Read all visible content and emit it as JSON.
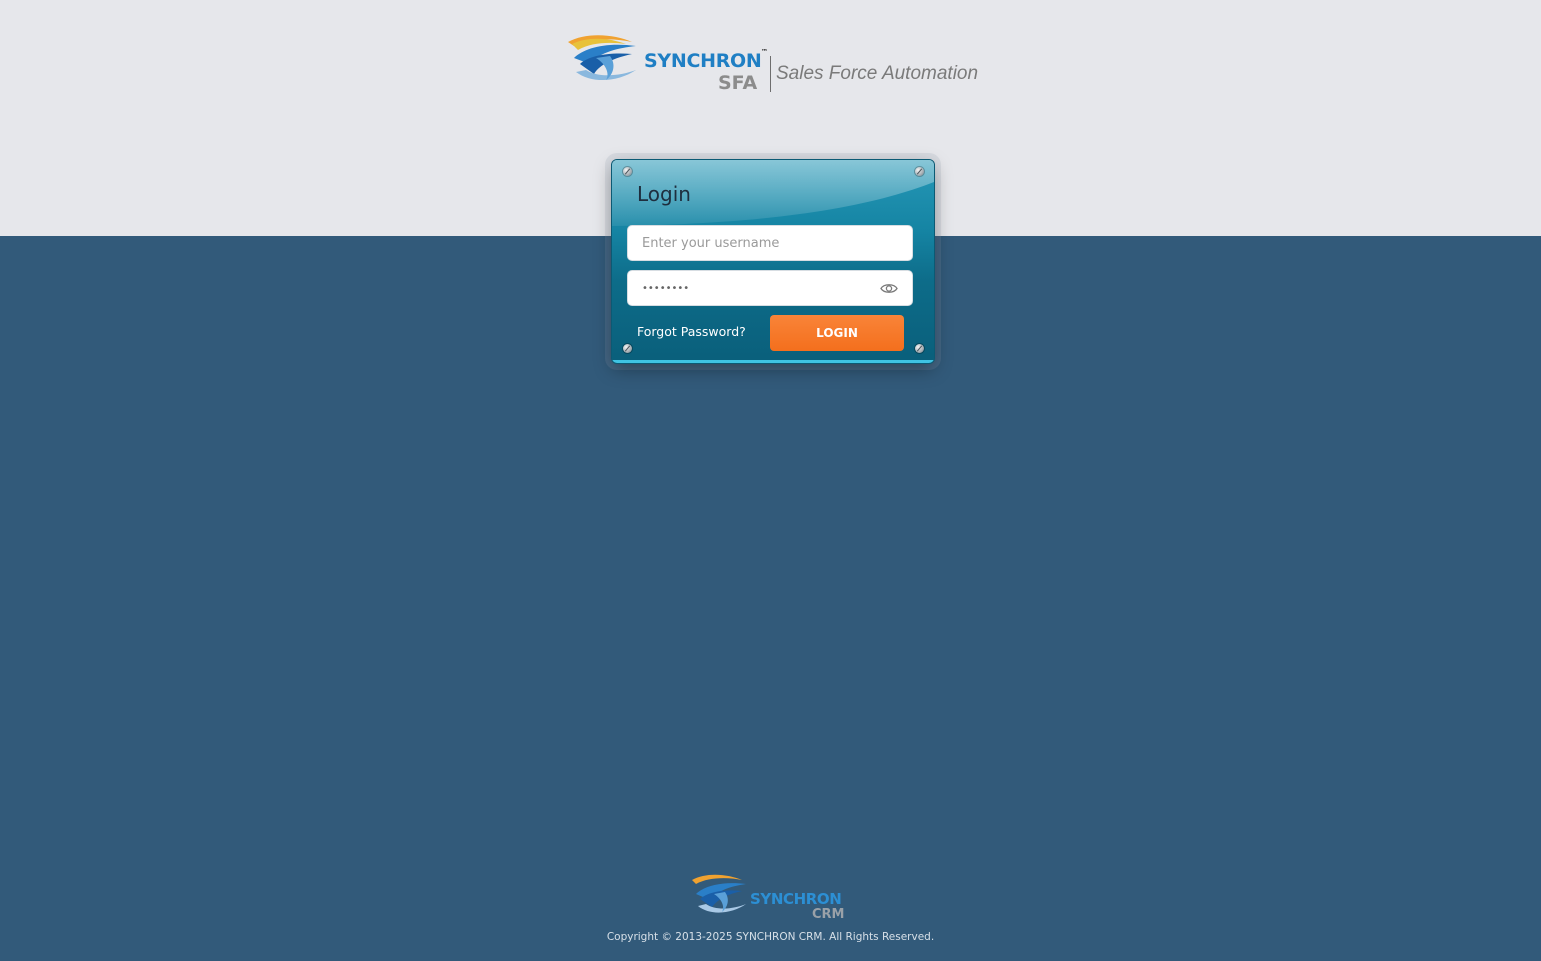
{
  "header": {
    "brand_name": "SYNCHRON",
    "brand_tm": "™",
    "brand_product": "SFA",
    "tagline": "Sales Force Automation",
    "logo_icon": "synchron-swoosh-logo"
  },
  "login": {
    "title": "Login",
    "username_placeholder": "Enter your username",
    "password_value": "••••••••",
    "show_password_icon": "eye-icon",
    "forgot_label": "Forgot Password?",
    "login_label": "LOGIN"
  },
  "footer": {
    "brand_name": "SYNCHRON",
    "brand_product": "CRM",
    "copyright": "Copyright © 2013-2025 SYNCHRON CRM. All Rights Reserved."
  },
  "colors": {
    "background_top": "#e6e7eb",
    "background_bottom": "#325a7a",
    "panel": "#1584a3",
    "login_button": "#f47a27",
    "brand_blue": "#1f7fc4"
  }
}
